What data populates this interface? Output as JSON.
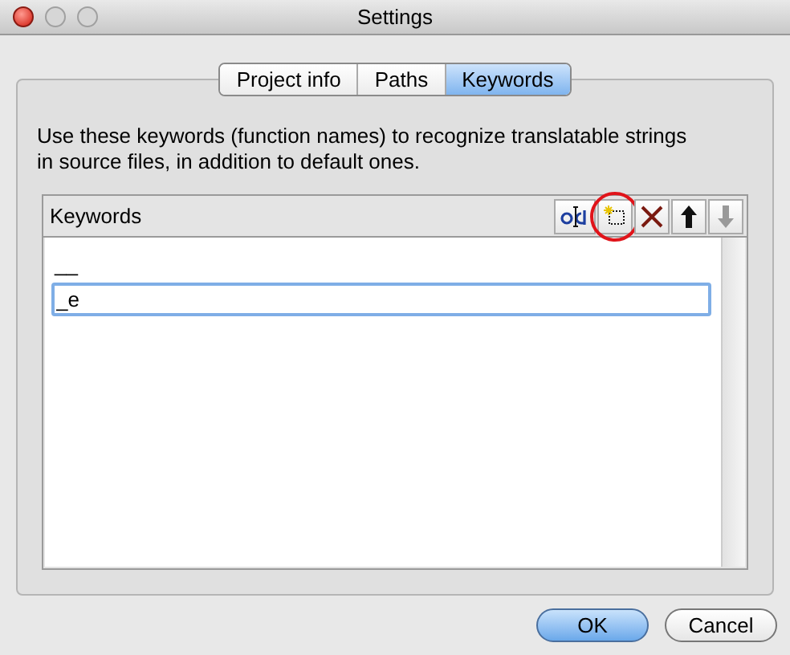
{
  "window": {
    "title": "Settings"
  },
  "tabs": [
    {
      "label": "Project info",
      "selected": false
    },
    {
      "label": "Paths",
      "selected": false
    },
    {
      "label": "Keywords",
      "selected": true
    }
  ],
  "description": "Use these keywords (function names) to recognize translatable strings in source files, in addition to default ones.",
  "keywords": {
    "header": "Keywords",
    "items": [
      {
        "text": "__",
        "editing": false
      },
      {
        "text": "_e",
        "editing": true
      }
    ],
    "toolbar": [
      {
        "kind": "rename",
        "disabled": false,
        "highlighted": false
      },
      {
        "kind": "add",
        "disabled": false,
        "highlighted": true
      },
      {
        "kind": "delete",
        "disabled": false,
        "highlighted": false
      },
      {
        "kind": "up",
        "disabled": false,
        "highlighted": false
      },
      {
        "kind": "down",
        "disabled": true,
        "highlighted": false
      }
    ]
  },
  "buttons": [
    {
      "label": "OK",
      "default": true
    },
    {
      "label": "Cancel",
      "default": false
    }
  ]
}
